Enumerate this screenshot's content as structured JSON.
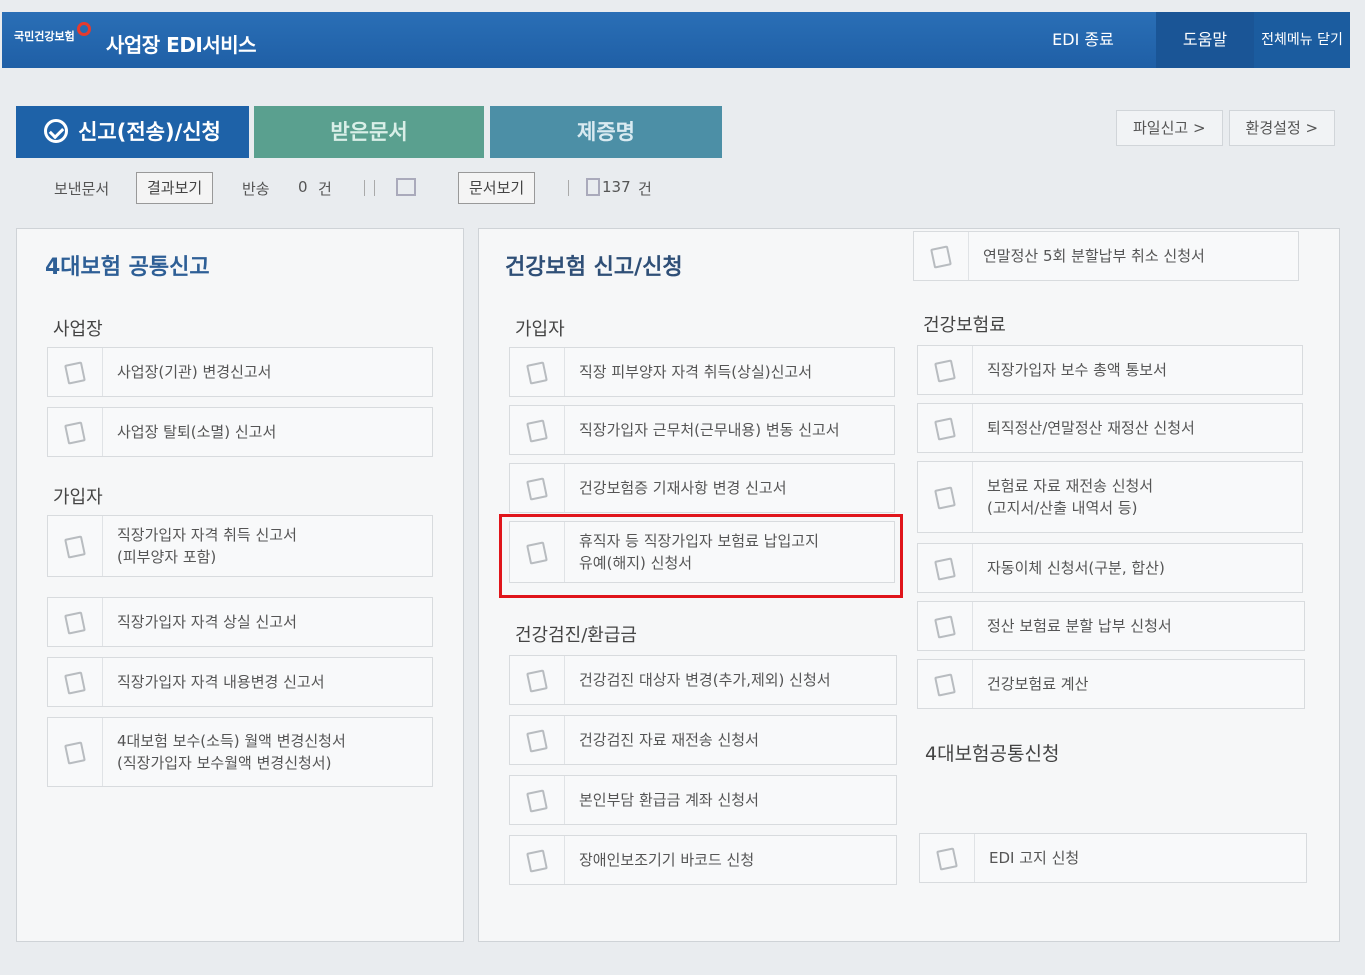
{
  "header": {
    "logo_text": "국민건강보험",
    "app_title": "사업장 EDI서비스",
    "buttons": {
      "edi_exit": "EDI 종료",
      "help": "도움말",
      "close_all": "전체메뉴 닫기"
    }
  },
  "tabs": [
    {
      "label": "신고(전송)/신청",
      "active": true
    },
    {
      "label": "받은문서",
      "active": false
    },
    {
      "label": "제증명",
      "active": false
    }
  ],
  "right_links": [
    "파일신고 >",
    "환경설정 >"
  ],
  "toolbar": {
    "sent_docs": "보낸문서",
    "view_results": "결과보기",
    "returned": "반송",
    "returned_count": "0",
    "unit1": "건",
    "view_docs": "문서보기",
    "doc_count": "137",
    "unit2": "건"
  },
  "left_panel": {
    "title": "4대보험 공통신고",
    "groups": [
      {
        "label": "사업장",
        "items": [
          "사업장(기관) 변경신고서",
          "사업장 탈퇴(소멸) 신고서"
        ]
      },
      {
        "label": "가입자",
        "items": [
          "직장가입자 자격 취득 신고서\n(피부양자 포함)",
          "직장가입자 자격 상실 신고서",
          "직장가입자 자격 내용변경 신고서",
          "4대보험 보수(소득) 월액 변경신청서\n(직장가입자 보수월액 변경신청서)"
        ]
      }
    ]
  },
  "mid_panel": {
    "title": "건강보험 신고/신청",
    "subscriber_label": "가입자",
    "subscriber_items": [
      "직장 피부양자 자격 취득(상실)신고서",
      "직장가입자 근무처(근무내용) 변동 신고서",
      "건강보험증 기재사항 변경 신고서",
      "휴직자 등 직장가입자 보험료 납입고지\n유예(해지) 신청서"
    ],
    "checkup_label": "건강검진/환급금",
    "checkup_items": [
      "건강검진 대상자 변경(추가,제외) 신청서",
      "건강검진 자료 재전송 신청서",
      "본인부담 환급금 계좌 신청서",
      "장애인보조기기 바코드 신청"
    ]
  },
  "right_col": {
    "top_item": "연말정산 5회 분할납부 취소 신청서",
    "premium_label": "건강보험료",
    "premium_items": [
      "직장가입자 보수 총액 통보서",
      "퇴직정산/연말정산 재정산 신청서",
      "보험료 자료 재전송 신청서\n(고지서/산출 내역서 등)",
      "자동이체 신청서(구분, 합산)",
      "정산 보험료 분할 납부 신청서",
      "건강보험료 계산"
    ],
    "common_label": "4대보험공통신청",
    "common_items": [
      "EDI 고지 신청"
    ]
  },
  "colors": {
    "header_blue": "#1f5fa6",
    "tab_active": "#1e62a8",
    "highlight_red": "#e0151b"
  }
}
